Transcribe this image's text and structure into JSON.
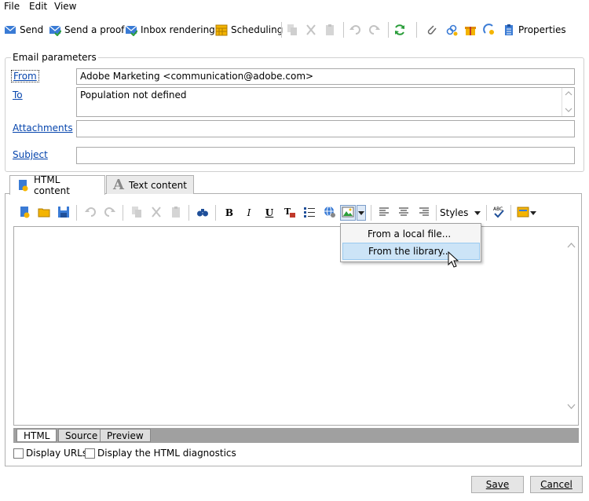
{
  "menu": [
    "File",
    "Edit",
    "View"
  ],
  "toolbar": {
    "send": "Send",
    "send_proof": "Send a proof",
    "inbox_rendering": "Inbox rendering",
    "scheduling": "Scheduling",
    "properties": "Properties"
  },
  "email_params": {
    "title": "Email parameters",
    "from_label": "From",
    "from_value": "Adobe Marketing <communication@adobe.com>",
    "to_label": "To",
    "to_value": "Population not defined",
    "attachments_label": "Attachments",
    "attachments_value": "",
    "subject_label": "Subject",
    "subject_value": ""
  },
  "content_tabs": [
    "HTML content",
    "Text content"
  ],
  "editor_toolbar": {
    "styles_label": "Styles"
  },
  "image_menu": {
    "items": [
      "From a local file...",
      "From the library..."
    ]
  },
  "view_tabs": [
    "HTML",
    "Source",
    "Preview"
  ],
  "options": {
    "display_urls": "Display URLs",
    "display_diagnostics": "Display the HTML diagnostics"
  },
  "dialog": {
    "save": "Save",
    "cancel": "Cancel"
  },
  "colors": {
    "link": "#0645ad",
    "hover_bg": "#cce4f7",
    "tab_strip": "#a0a0a0"
  }
}
